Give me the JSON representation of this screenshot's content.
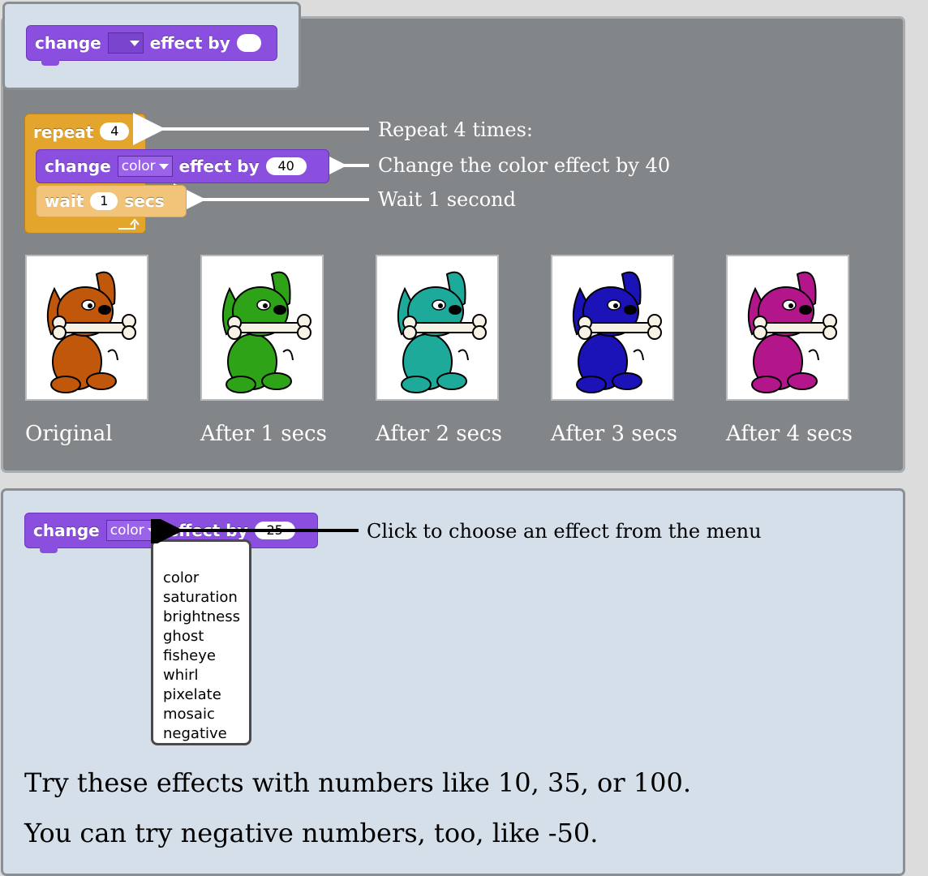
{
  "top_block": {
    "label_change": "change",
    "label_effect_by": "effect by"
  },
  "script": {
    "repeat_label": "repeat",
    "repeat_count": "4",
    "change_label": "change",
    "change_effect": "color",
    "change_effect_by": "effect by",
    "change_value": "40",
    "wait_label": "wait",
    "wait_value": "1",
    "wait_unit": "secs"
  },
  "annotations": {
    "repeat": "Repeat 4 times:",
    "change": "Change the color effect by 40",
    "wait": "Wait 1 second",
    "menu_hint": "Click to choose an effect from the menu"
  },
  "images": [
    {
      "caption": "Original",
      "color": "#c0570b"
    },
    {
      "caption": "After 1 secs",
      "color": "#2fa318"
    },
    {
      "caption": "After 2 secs",
      "color": "#1eaa9b"
    },
    {
      "caption": "After 3 secs",
      "color": "#1b12b8"
    },
    {
      "caption": "After 4 secs",
      "color": "#b3168a"
    }
  ],
  "bottom_block": {
    "label_change": "change",
    "effect": "color",
    "label_effect_by": "effect by",
    "value": "25"
  },
  "menu": {
    "options": [
      "color",
      "saturation",
      "brightness",
      "ghost",
      "fisheye",
      "whirl",
      "pixelate",
      "mosaic",
      "negative"
    ]
  },
  "text": {
    "line1": "Try these effects with numbers like 10, 35, or 100.",
    "line2": "You can try negative numbers, too, like -50."
  },
  "colors": {
    "block_purple": "#8b4fe0",
    "block_orange": "#e3a52c",
    "panel_gray": "#828689",
    "panel_blue": "#d5dfea"
  }
}
